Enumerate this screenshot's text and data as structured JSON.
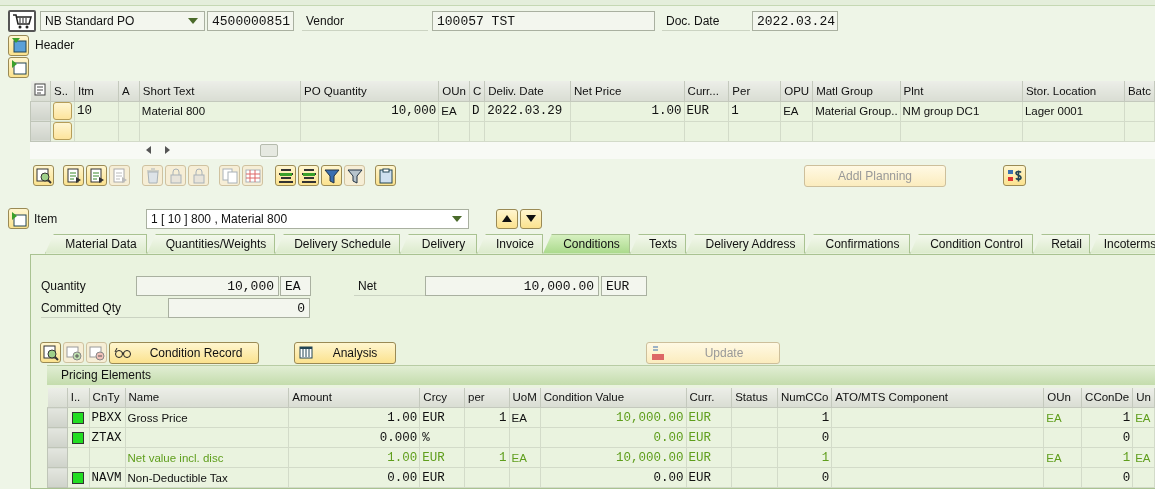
{
  "header": {
    "doc_type": "NB Standard PO",
    "po_number": "4500000851",
    "vendor_label": "Vendor",
    "vendor": "100057 TST",
    "doc_date_label": "Doc. Date",
    "doc_date": "2022.03.24",
    "section_label": "Header"
  },
  "items_table": {
    "columns": [
      "S..",
      "Itm",
      "A",
      "Short Text",
      "PO Quantity",
      "OUn",
      "C",
      "Deliv. Date",
      "Net Price",
      "Curr...",
      "Per",
      "OPU",
      "Matl Group",
      "Plnt",
      "Stor. Location",
      "Batc"
    ],
    "rows": [
      {
        "selected": false,
        "cells": [
          null,
          "10",
          null,
          "Material 800",
          "10,000",
          "EA",
          "D",
          "2022.03.29",
          "1.00",
          "EUR",
          "1",
          "EA",
          "Material Group..",
          "NM group DC1",
          "Lager 0001",
          null
        ]
      }
    ]
  },
  "toolbar": [
    {
      "disabled": false
    },
    {
      "disabled": false
    },
    {
      "disabled": false
    },
    {
      "disabled": true
    },
    {
      "disabled": true
    },
    {
      "disabled": true
    },
    {
      "disabled": true
    },
    {
      "disabled": true
    },
    {
      "disabled": true
    },
    {
      "disabled": false
    },
    {
      "disabled": false
    },
    {
      "disabled": false
    },
    {
      "disabled": true
    },
    {
      "disabled": false
    }
  ],
  "addl_planning": {
    "label": "Addl Planning",
    "disabled": true
  },
  "item_selector": {
    "label": "Item",
    "value": "1 [ 10 ] 800 , Material 800"
  },
  "tabs": [
    {
      "label": "Material Data",
      "selected": false
    },
    {
      "label": "Quantities/Weights",
      "selected": false
    },
    {
      "label": "Delivery Schedule",
      "selected": false
    },
    {
      "label": "Delivery",
      "selected": false
    },
    {
      "label": "Invoice",
      "selected": false
    },
    {
      "label": "Conditions",
      "selected": true
    },
    {
      "label": "Texts",
      "selected": false
    },
    {
      "label": "Delivery Address",
      "selected": false
    },
    {
      "label": "Confirmations",
      "selected": false
    },
    {
      "label": "Condition Control",
      "selected": false
    },
    {
      "label": "Retail",
      "selected": false
    },
    {
      "label": "Incoterms",
      "selected": false
    }
  ],
  "conditions": {
    "quantity_label": "Quantity",
    "quantity": "10,000",
    "quantity_unit": "EA",
    "net_label": "Net",
    "net": "10,000.00",
    "net_currency": "EUR",
    "committed_label": "Committed Qty",
    "committed": "0",
    "icon_buttons": [
      {
        "disabled": false
      },
      {
        "disabled": true
      },
      {
        "disabled": true
      }
    ],
    "buttons": [
      {
        "label": "Condition Record",
        "disabled": false
      },
      {
        "label": "Analysis",
        "disabled": false
      },
      {
        "label": "Update",
        "disabled": true
      }
    ],
    "pricing": {
      "title": "Pricing Elements",
      "columns": [
        "I..",
        "CnTy",
        "Name",
        "Amount",
        "Crcy",
        "per",
        "UoM",
        "Condition Value",
        "Curr.",
        "Status",
        "NumCCo",
        "ATO/MTS Component",
        "OUn",
        "CConDe",
        "Un"
      ],
      "rows": [
        {
          "kind": "condition",
          "color": "#22dd22",
          "value_highlighted": true,
          "cells": [
            null,
            "PBXX",
            "Gross Price",
            "1.00",
            "EUR",
            "1",
            "EA",
            "10,000.00",
            "EUR",
            null,
            "1",
            null,
            "EA",
            "1",
            "EA"
          ]
        },
        {
          "kind": "condition",
          "color": "#22dd22",
          "value_highlighted": true,
          "cells": [
            null,
            "ZTAX",
            null,
            "0.000",
            "%",
            null,
            null,
            "0.00",
            "EUR",
            null,
            "0",
            null,
            null,
            "0",
            null
          ]
        },
        {
          "kind": "subtotal",
          "cells": [
            null,
            null,
            "Net value incl. disc",
            "1.00",
            "EUR",
            "1",
            "EA",
            "10,000.00",
            "EUR",
            null,
            "1",
            null,
            "EA",
            "1",
            "EA"
          ]
        },
        {
          "kind": "condition",
          "color": "#22dd22",
          "value_highlighted": false,
          "cells": [
            null,
            "NAVM",
            "Non-Deductible Tax",
            "0.00",
            "EUR",
            null,
            null,
            "0.00",
            "EUR",
            null,
            "0",
            null,
            null,
            "0",
            null
          ]
        }
      ]
    }
  }
}
